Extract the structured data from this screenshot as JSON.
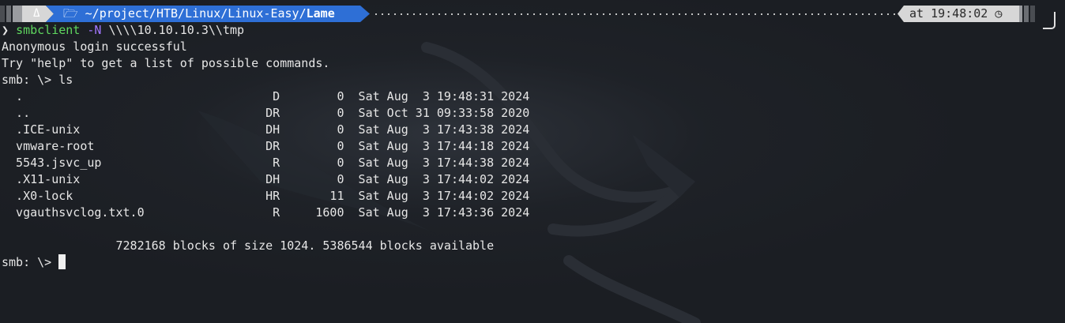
{
  "prompt_bar": {
    "os_icon": "Δ",
    "folder_icon": "folder-icon",
    "path_prefix": "~/project/HTB/Linux/Linux-Easy/",
    "path_last": "Lame",
    "time_label": "at 19:48:02",
    "clock_icon": "◷",
    "path_color": "#2e6fd6"
  },
  "command": {
    "chevron": "❯",
    "program": "smbclient",
    "flag": "-N",
    "arg": "\\\\\\\\10.10.10.3\\\\tmp"
  },
  "output": {
    "line1": "Anonymous login successful",
    "line2": "Try \"help\" to get a list of possible commands.",
    "line3": "smb: \\> ls"
  },
  "listing": [
    "  .                                   D        0  Sat Aug  3 19:48:31 2024",
    "  ..                                 DR        0  Sat Oct 31 09:33:58 2020",
    "  .ICE-unix                          DH        0  Sat Aug  3 17:43:38 2024",
    "  vmware-root                        DR        0  Sat Aug  3 17:44:18 2024",
    "  5543.jsvc_up                        R        0  Sat Aug  3 17:44:38 2024",
    "  .X11-unix                          DH        0  Sat Aug  3 17:44:02 2024",
    "  .X0-lock                           HR       11  Sat Aug  3 17:44:02 2024",
    "  vgauthsvclog.txt.0                  R     1600  Sat Aug  3 17:43:36 2024"
  ],
  "blocks_line": "                7282168 blocks of size 1024. 5386544 blocks available",
  "final_prompt": "smb: \\> "
}
